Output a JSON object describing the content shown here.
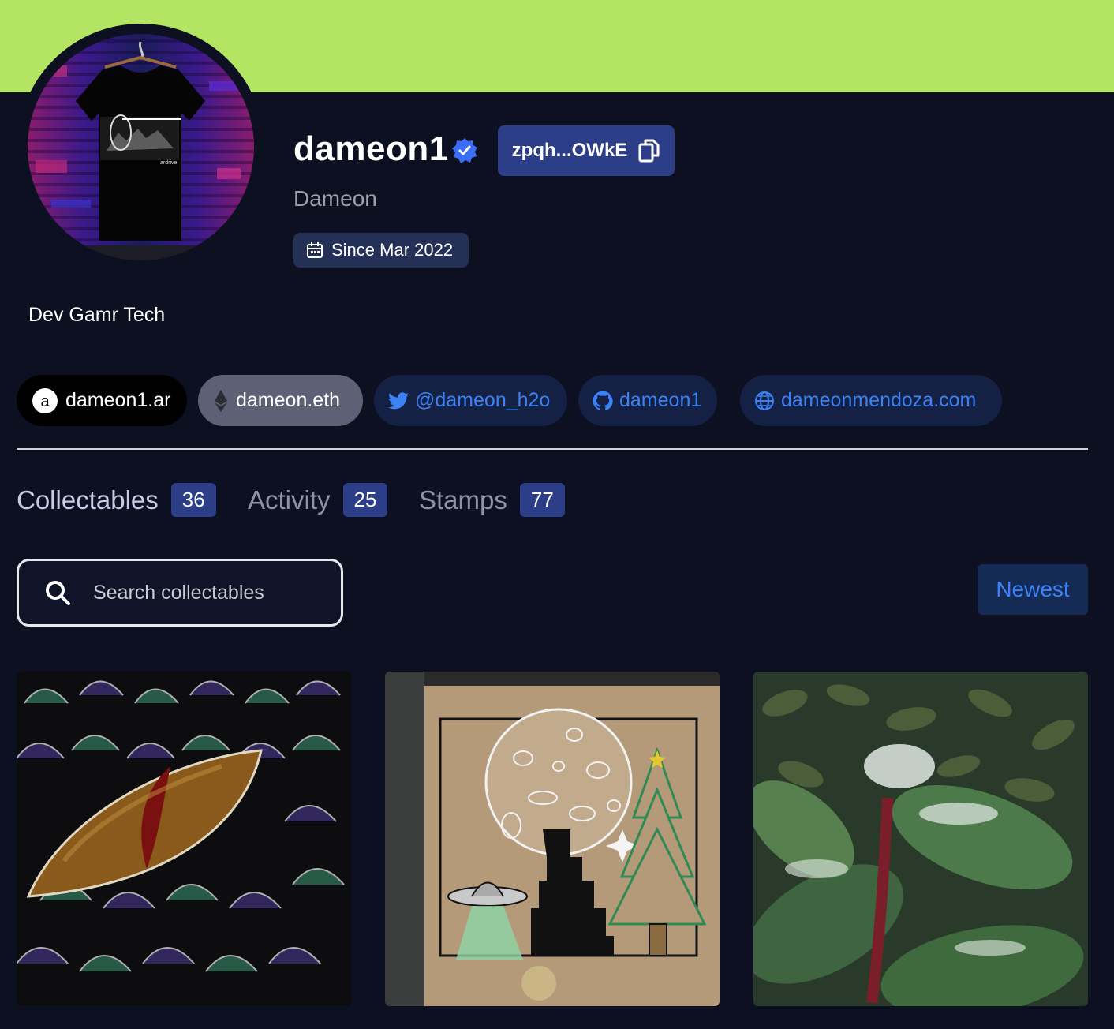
{
  "profile": {
    "username": "dameon1",
    "address_short": "zpqh...OWkE",
    "display_name": "Dameon",
    "since": "Since Mar 2022",
    "bio": "Dev Gamr Tech",
    "verified_icon": "verified-check-icon",
    "copy_icon": "copy-icon",
    "calendar_icon": "calendar-icon"
  },
  "avatar": {
    "shirt_text": "ardrive"
  },
  "links": [
    {
      "label": "dameon1.ar",
      "icon": "ar-icon"
    },
    {
      "label": "dameon.eth",
      "icon": "eth-icon"
    },
    {
      "label": "@dameon_h2o",
      "icon": "twitter-icon"
    },
    {
      "label": "dameon1",
      "icon": "github-icon"
    },
    {
      "label": "dameonmendoza.com",
      "icon": "globe-icon"
    }
  ],
  "tabs": [
    {
      "label": "Collectables",
      "count": "36"
    },
    {
      "label": "Activity",
      "count": "25"
    },
    {
      "label": "Stamps",
      "count": "77"
    }
  ],
  "search": {
    "placeholder": "Search collectables"
  },
  "sort": {
    "label": "Newest"
  },
  "colors": {
    "banner": "#b3e462",
    "background": "#0c1020",
    "accent": "#2c3e87",
    "link": "#3b82f6"
  },
  "collectables": [
    {
      "name": "dragon-eye-artwork"
    },
    {
      "name": "moon-tower-artwork"
    },
    {
      "name": "snowy-leaves-photo"
    }
  ]
}
